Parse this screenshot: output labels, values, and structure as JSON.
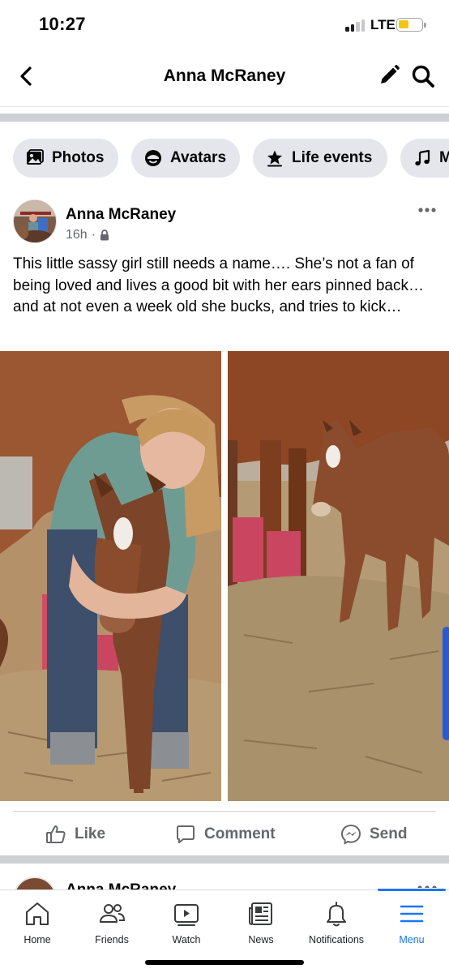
{
  "status_bar": {
    "time": "10:27",
    "network": "LTE"
  },
  "nav": {
    "title": "Anna McRaney"
  },
  "chips": [
    {
      "label": "Photos",
      "icon": "photos-icon"
    },
    {
      "label": "Avatars",
      "icon": "avatar-icon"
    },
    {
      "label": "Life events",
      "icon": "star-flag-icon"
    },
    {
      "label": "M",
      "icon": "music-note-icon"
    }
  ],
  "post": {
    "author": "Anna McRaney",
    "time": "16h",
    "dot": "·",
    "privacy_icon": "lock-icon",
    "text": "This little sassy girl still needs a name…. She’s not a fan of being loved and lives a good bit with her ears pinned back…  and at not even a week old she bucks, and tries to kick…"
  },
  "actions": {
    "like": "Like",
    "comment": "Comment",
    "send": "Send"
  },
  "next_post": {
    "author": "Anna McRaney"
  },
  "tabs": [
    {
      "label": "Home",
      "icon": "home-icon"
    },
    {
      "label": "Friends",
      "icon": "friends-icon"
    },
    {
      "label": "Watch",
      "icon": "watch-icon"
    },
    {
      "label": "News",
      "icon": "news-icon"
    },
    {
      "label": "Notifications",
      "icon": "bell-icon"
    },
    {
      "label": "Menu",
      "icon": "menu-icon",
      "active": true
    }
  ],
  "colors": {
    "accent": "#1877f2",
    "chip_bg": "#e4e6eb",
    "secondary_text": "#65676b",
    "battery": "#f2c713"
  }
}
